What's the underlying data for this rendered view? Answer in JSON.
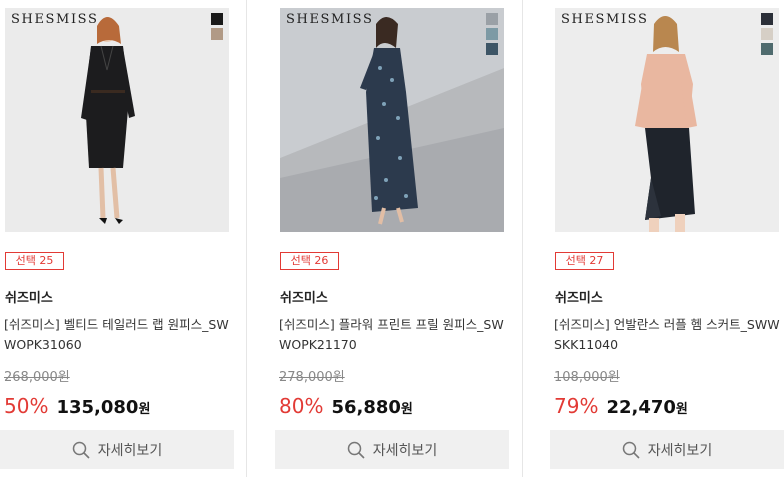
{
  "products": [
    {
      "logo": "SHESMISS",
      "swatch_colors": [
        "#1a1a1a",
        "#b19a86"
      ],
      "tag": "선택 25",
      "brand": "쉬즈미스",
      "name": "[쉬즈미스] 벨티드 테일러드 랩 원피스_SWWOPK31060",
      "original_price": "268,000원",
      "discount": "50%",
      "price": "135,080",
      "currency": "원",
      "button_label": "자세히보기"
    },
    {
      "logo": "SHESMISS",
      "swatch_colors": [
        "#9aa0a6",
        "#7d9aa5",
        "#3d5566"
      ],
      "tag": "선택 26",
      "brand": "쉬즈미스",
      "name": "[쉬즈미스] 플라워 프린트 프릴 원피스_SWWOPK21170",
      "original_price": "278,000원",
      "discount": "80%",
      "price": "56,880",
      "currency": "원",
      "button_label": "자세히보기"
    },
    {
      "logo": "SHESMISS",
      "swatch_colors": [
        "#2b2f38",
        "#d6cfc6",
        "#4f6b6e"
      ],
      "tag": "선택 27",
      "brand": "쉬즈미스",
      "name": "[쉬즈미스] 언발란스 러플 헴 스커트_SWWSKK11040",
      "original_price": "108,000원",
      "discount": "79%",
      "price": "22,470",
      "currency": "원",
      "button_label": "자세히보기"
    }
  ],
  "icons": {
    "search": "search-icon"
  }
}
